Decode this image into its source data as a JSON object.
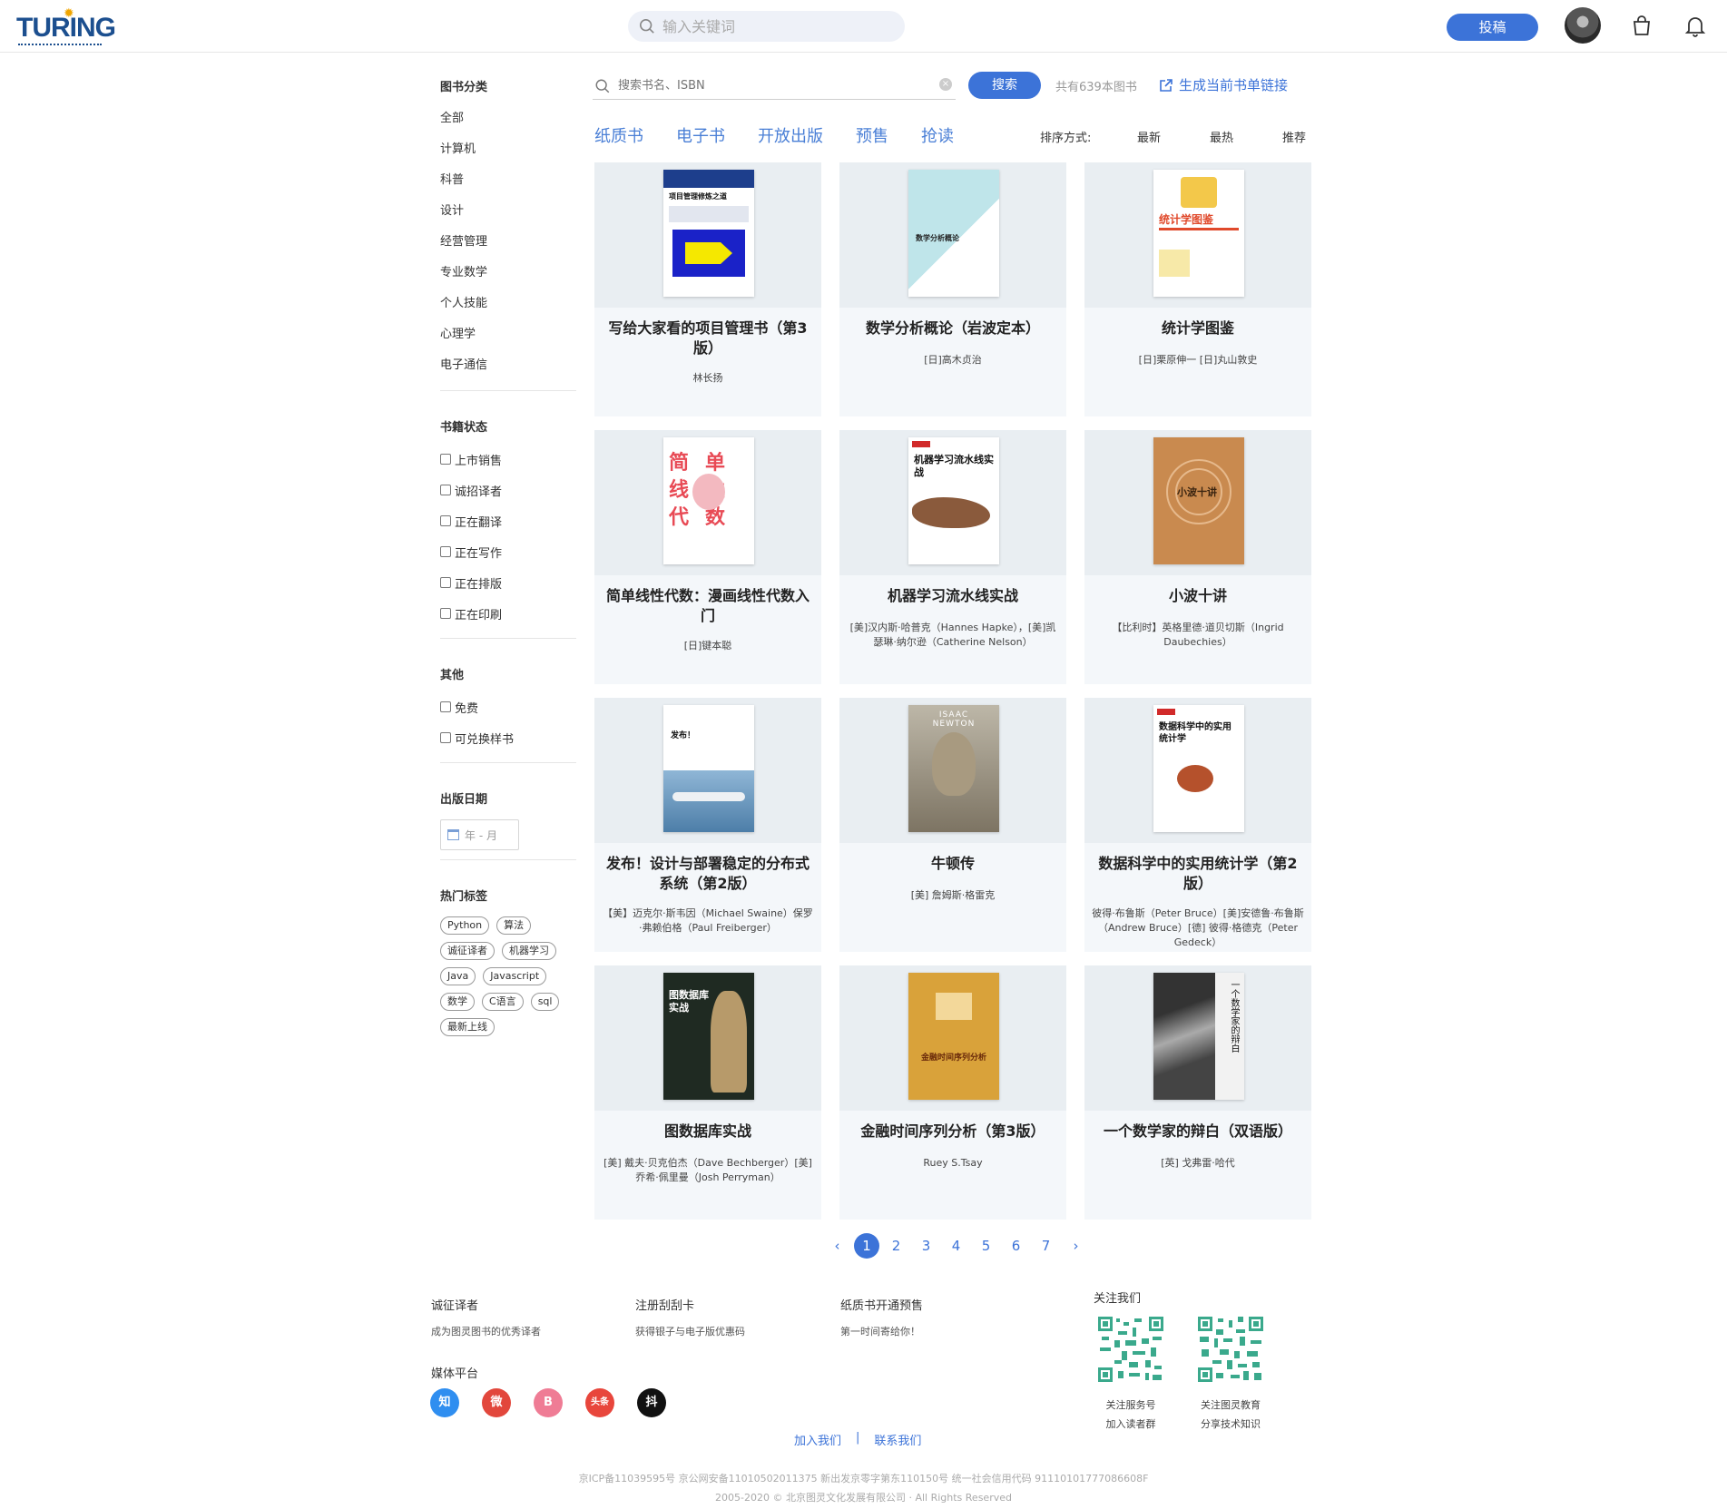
{
  "header": {
    "logo_text": "TURING",
    "search_placeholder": "输入关键词",
    "submit_label": "投稿"
  },
  "sidebar": {
    "category_title": "图书分类",
    "categories": [
      "全部",
      "计算机",
      "科普",
      "设计",
      "经营管理",
      "专业数学",
      "个人技能",
      "心理学",
      "电子通信"
    ],
    "status_title": "书籍状态",
    "statuses": [
      "上市销售",
      "诚招译者",
      "正在翻译",
      "正在写作",
      "正在排版",
      "正在印刷"
    ],
    "other_title": "其他",
    "others": [
      "免费",
      "可兑换样书"
    ],
    "date_title": "出版日期",
    "date_placeholder": "年 - 月",
    "tags_title": "热门标签",
    "tags": [
      "Python",
      "算法",
      "诚征译者",
      "机器学习",
      "Java",
      "Javascript",
      "数学",
      "C语言",
      "sql",
      "最新上线"
    ]
  },
  "main": {
    "search_placeholder": "搜索书名、ISBN",
    "search_button": "搜索",
    "total_text": "共有639本图书",
    "gen_link": "生成当前书单链接",
    "tabs": [
      "纸质书",
      "电子书",
      "开放出版",
      "预售",
      "抢读"
    ],
    "sort_label": "排序方式:",
    "sort_options": [
      "最新",
      "最热",
      "推荐"
    ]
  },
  "books": [
    {
      "title": "写给大家看的项目管理书（第3版）",
      "author": "林长扬",
      "cover_text": "项目管理修炼之道"
    },
    {
      "title": "数学分析概论（岩波定本）",
      "author": "[日]高木贞治",
      "cover_text": "数学分析概论"
    },
    {
      "title": "统计学图鉴",
      "author": "[日]栗原伸一 [日]丸山敦史",
      "cover_text": "统计学图鉴"
    },
    {
      "title": "简单线性代数：漫画线性代数入门",
      "author": "[日]键本聪",
      "cover_text": "简单线性代数"
    },
    {
      "title": "机器学习流水线实战",
      "author": "[美]汉内斯·哈普克（Hannes Hapke），[美]凯瑟琳·纳尔逊（Catherine Nelson）",
      "cover_text": "机器学习流水线实战"
    },
    {
      "title": "小波十讲",
      "author": "【比利时】英格里德·道贝切斯（Ingrid Daubechies）",
      "cover_text": "小波十讲"
    },
    {
      "title": "发布！设计与部署稳定的分布式系统（第2版）",
      "author": "【美】迈克尔·斯韦因（Michael Swaine）保罗·弗赖伯格（Paul Freiberger）",
      "cover_text": "发布！"
    },
    {
      "title": "牛顿传",
      "author": "[美] 詹姆斯·格雷克",
      "cover_text": "ISAAC NEWTON"
    },
    {
      "title": "数据科学中的实用统计学（第2版）",
      "author": "彼得·布鲁斯（Peter Bruce）[美]安德鲁·布鲁斯（Andrew Bruce）[德] 彼得·格德克（Peter Gedeck）",
      "cover_text": "数据科学中的实用统计学"
    },
    {
      "title": "图数据库实战",
      "author": "[美] 戴夫·贝克伯杰（Dave Bechberger）[美] 乔希·佩里曼（Josh Perryman）",
      "cover_text": "图数据库实战"
    },
    {
      "title": "金融时间序列分析（第3版）",
      "author": "Ruey S.Tsay",
      "cover_text": "金融时间序列分析"
    },
    {
      "title": "一个数学家的辩白（双语版）",
      "author": "[英] 戈弗雷·哈代",
      "cover_text": "一个数学家的辩白"
    }
  ],
  "pagination": {
    "pages": [
      "1",
      "2",
      "3",
      "4",
      "5",
      "6",
      "7"
    ],
    "current": "1"
  },
  "footer": {
    "cols": [
      {
        "title": "诚征译者",
        "sub": "成为图灵图书的优秀译者"
      },
      {
        "title": "注册刮刮卡",
        "sub": "获得银子与电子版优惠码"
      },
      {
        "title": "纸质书开通预售",
        "sub": "第一时间寄给你！"
      }
    ],
    "media_label": "媒体平台",
    "media": [
      "知",
      "微",
      "B",
      "头条",
      "抖"
    ],
    "follow_label": "关注我们",
    "qr1": [
      "关注服务号",
      "加入读者群"
    ],
    "qr2": [
      "关注图灵教育",
      "分享技术知识"
    ],
    "join": "加入我们",
    "sep": "|",
    "contact": "联系我们",
    "icp": "京ICP备11039595号 京公网安备11010502011375 新出发京零字第东110150号 统一社会信用代码 91110101777086608F",
    "copyright": "2005-2020 © 北京图灵文化发展有限公司 · All Rights Reserved"
  },
  "colors": {
    "accent": "#3c73d8",
    "card_bg": "#f4f7fa"
  }
}
